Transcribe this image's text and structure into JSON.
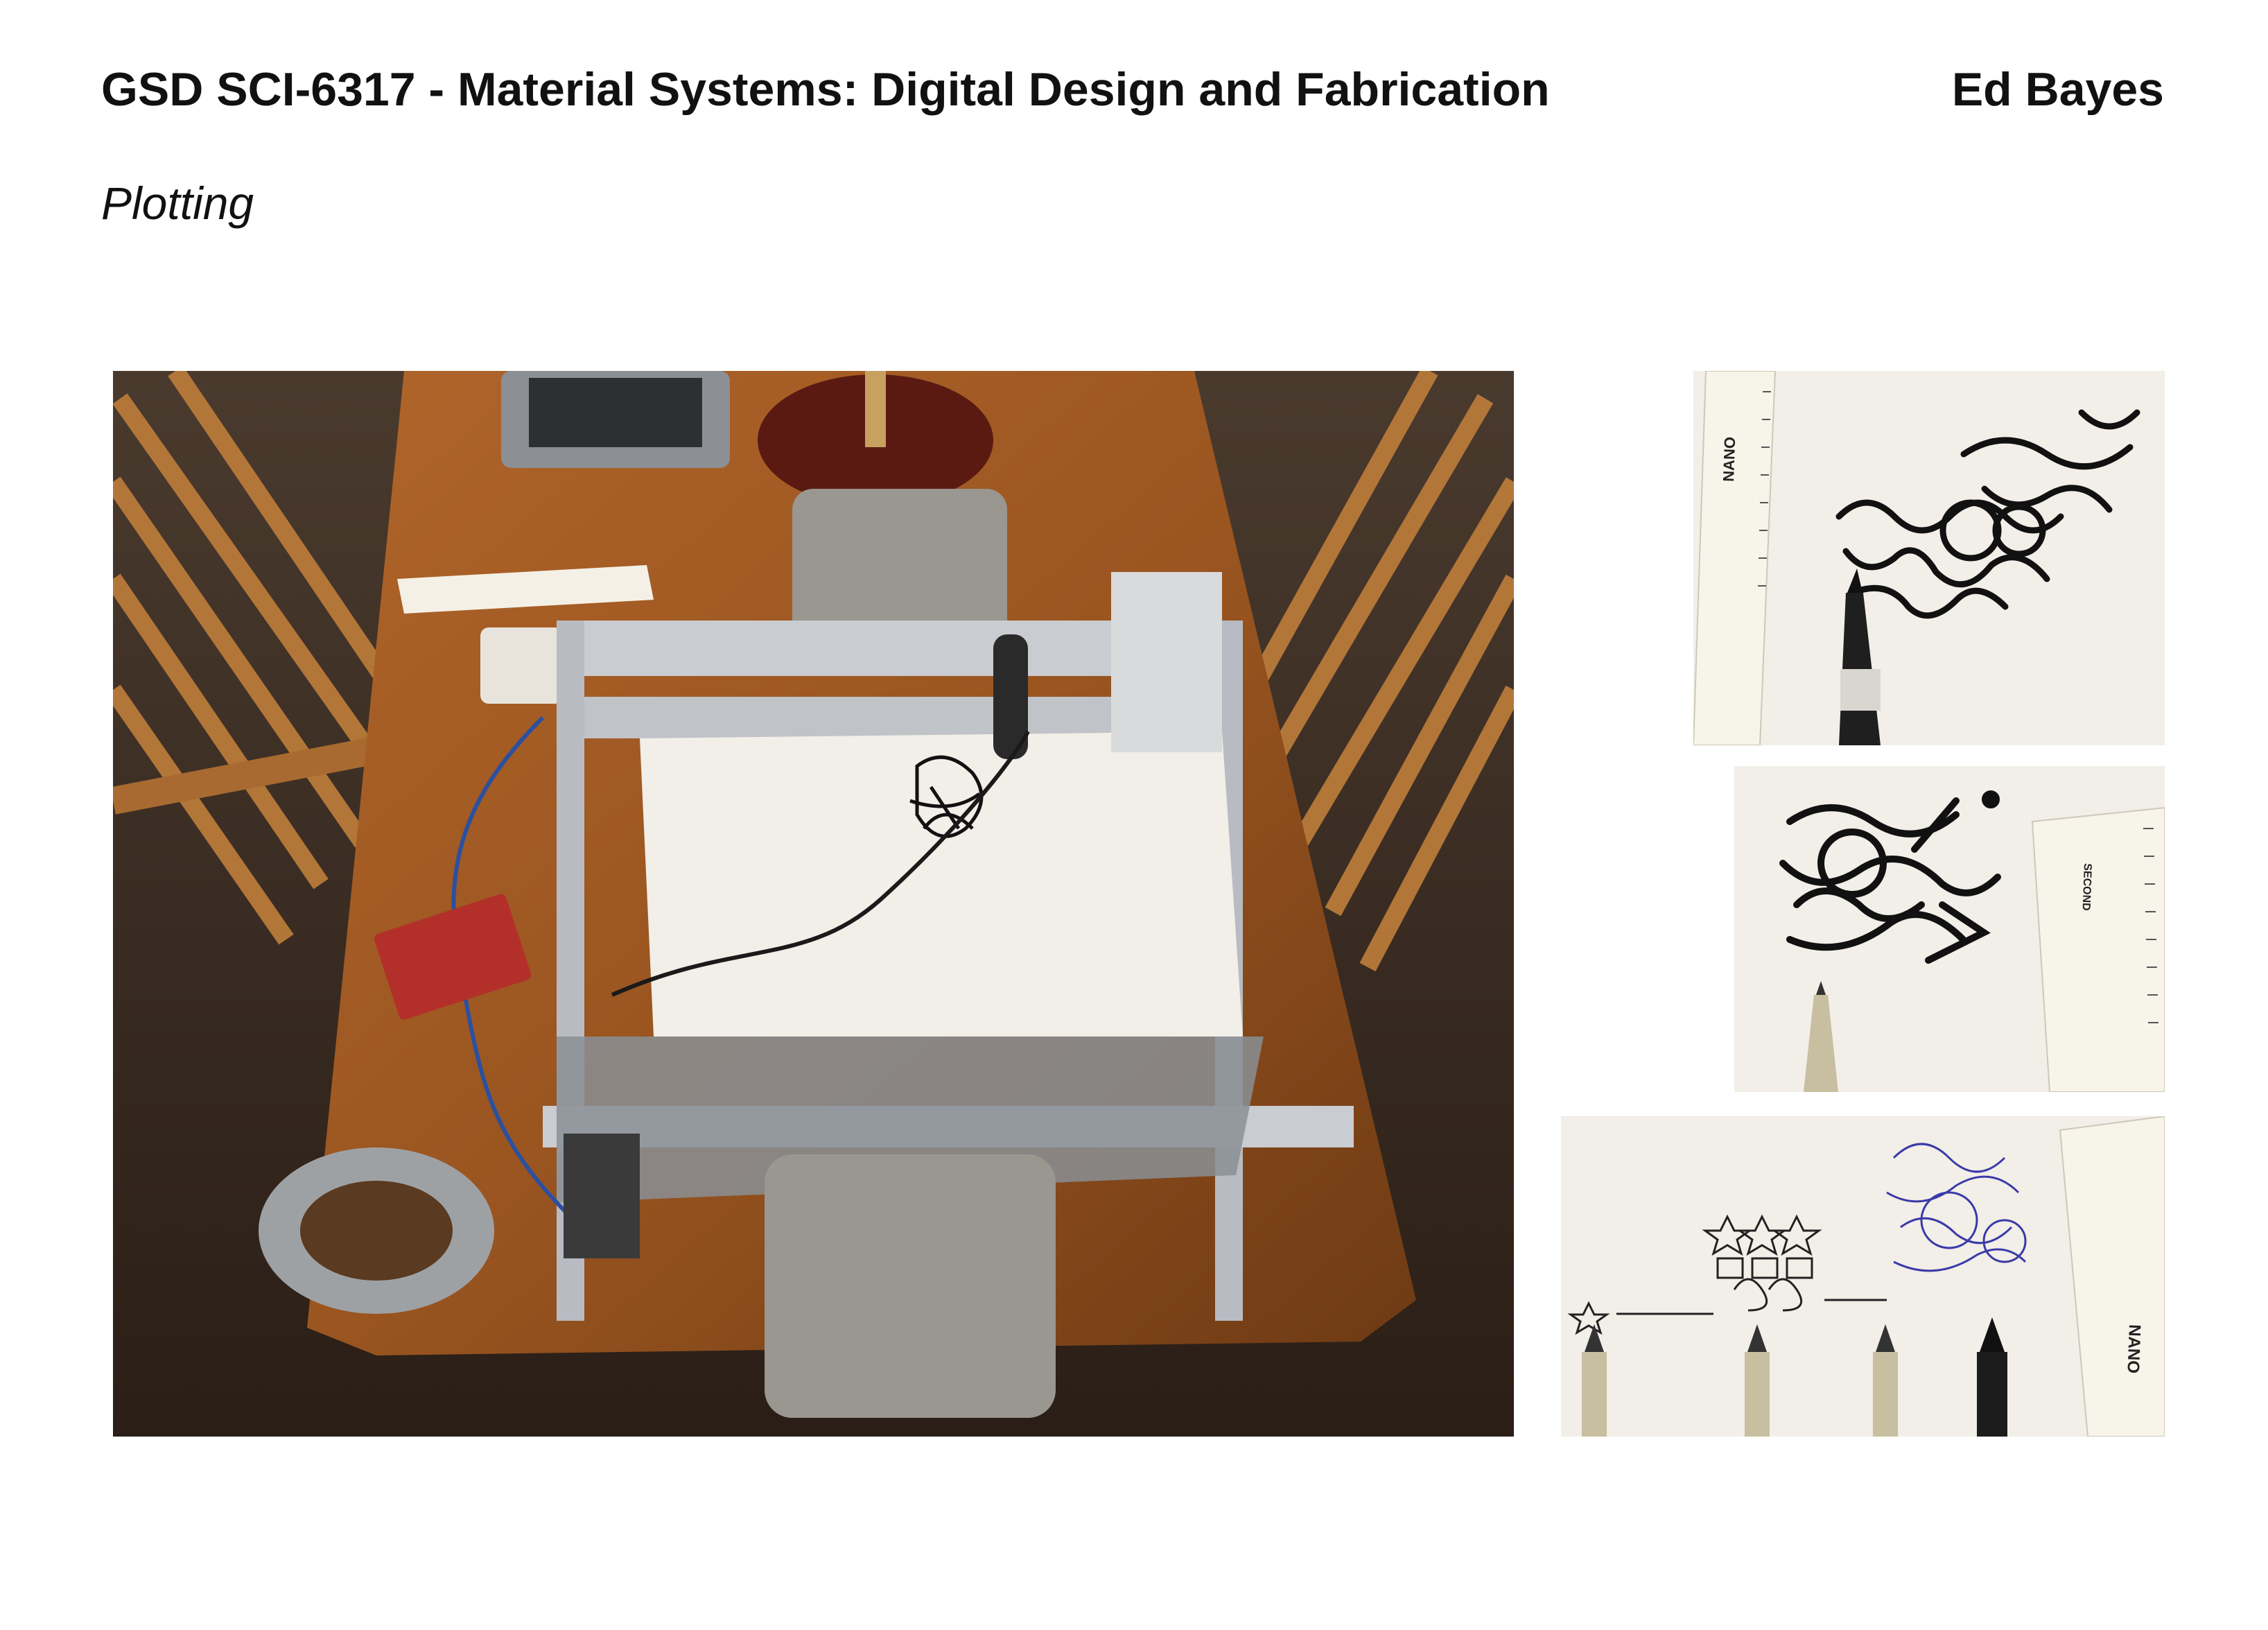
{
  "header": {
    "course_title": "GSD SCI-6317 - Material Systems: Digital Design and Fabrication",
    "author": "Ed Bayes"
  },
  "section": {
    "title": "Plotting"
  },
  "photos": {
    "main": "pen plotter on wooden table",
    "detail_1": "marker drawing with ruler",
    "detail_2": "fineliner drawing with ruler",
    "detail_3": "pen line-weight tests with ruler"
  },
  "ruler_text": {
    "brand": "NANO",
    "second_label": "SECOND"
  },
  "colors": {
    "table_wood": "#9a5520",
    "floor_dark": "#3a2a20",
    "paper": "#f2eee8",
    "aluminium": "#c9ccd0",
    "ink": "#111111",
    "blue_ink": "#3a3aa8"
  }
}
